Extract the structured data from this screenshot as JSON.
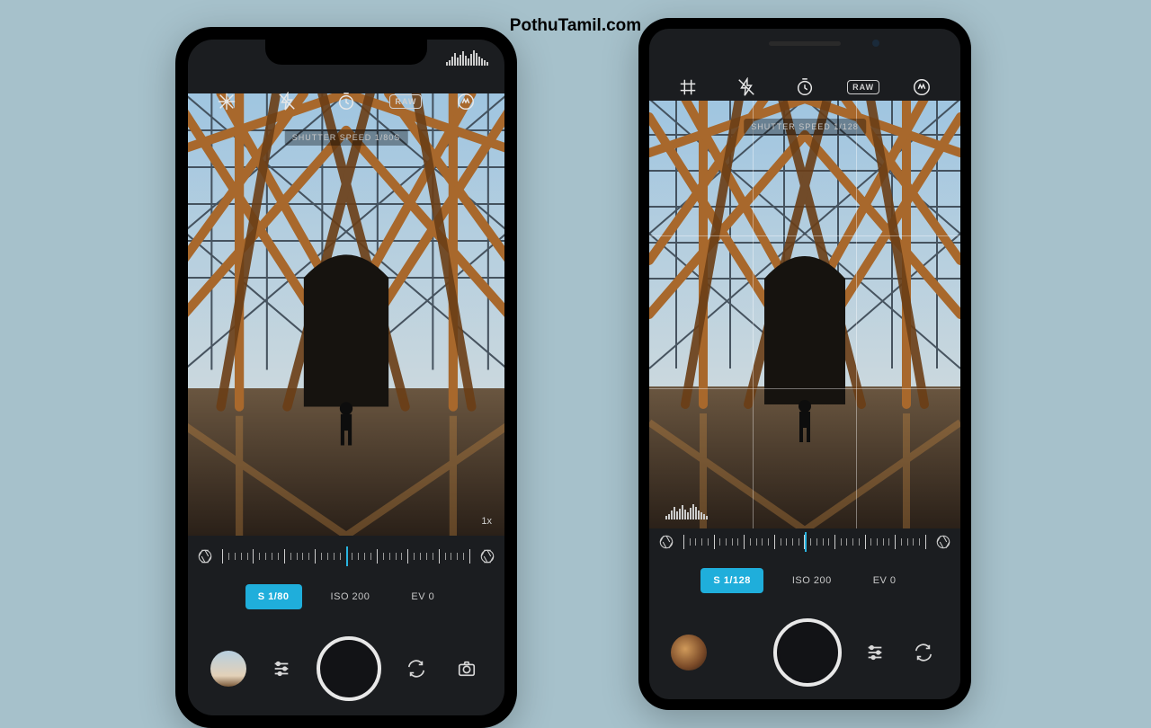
{
  "watermark": "PothuTamil.com",
  "iphone": {
    "topbar": {
      "raw": "RAW"
    },
    "shutter_label": "SHUTTER SPEED  1/80S",
    "zoom": "1x",
    "settings": {
      "shutter": "S 1/80",
      "iso": "ISO 200",
      "ev": "EV 0"
    }
  },
  "pixel": {
    "topbar": {
      "raw": "RAW"
    },
    "shutter_label": "SHUTTER SPEED  1/128",
    "settings": {
      "shutter": "S 1/128",
      "iso": "ISO 200",
      "ev": "EV 0"
    }
  }
}
